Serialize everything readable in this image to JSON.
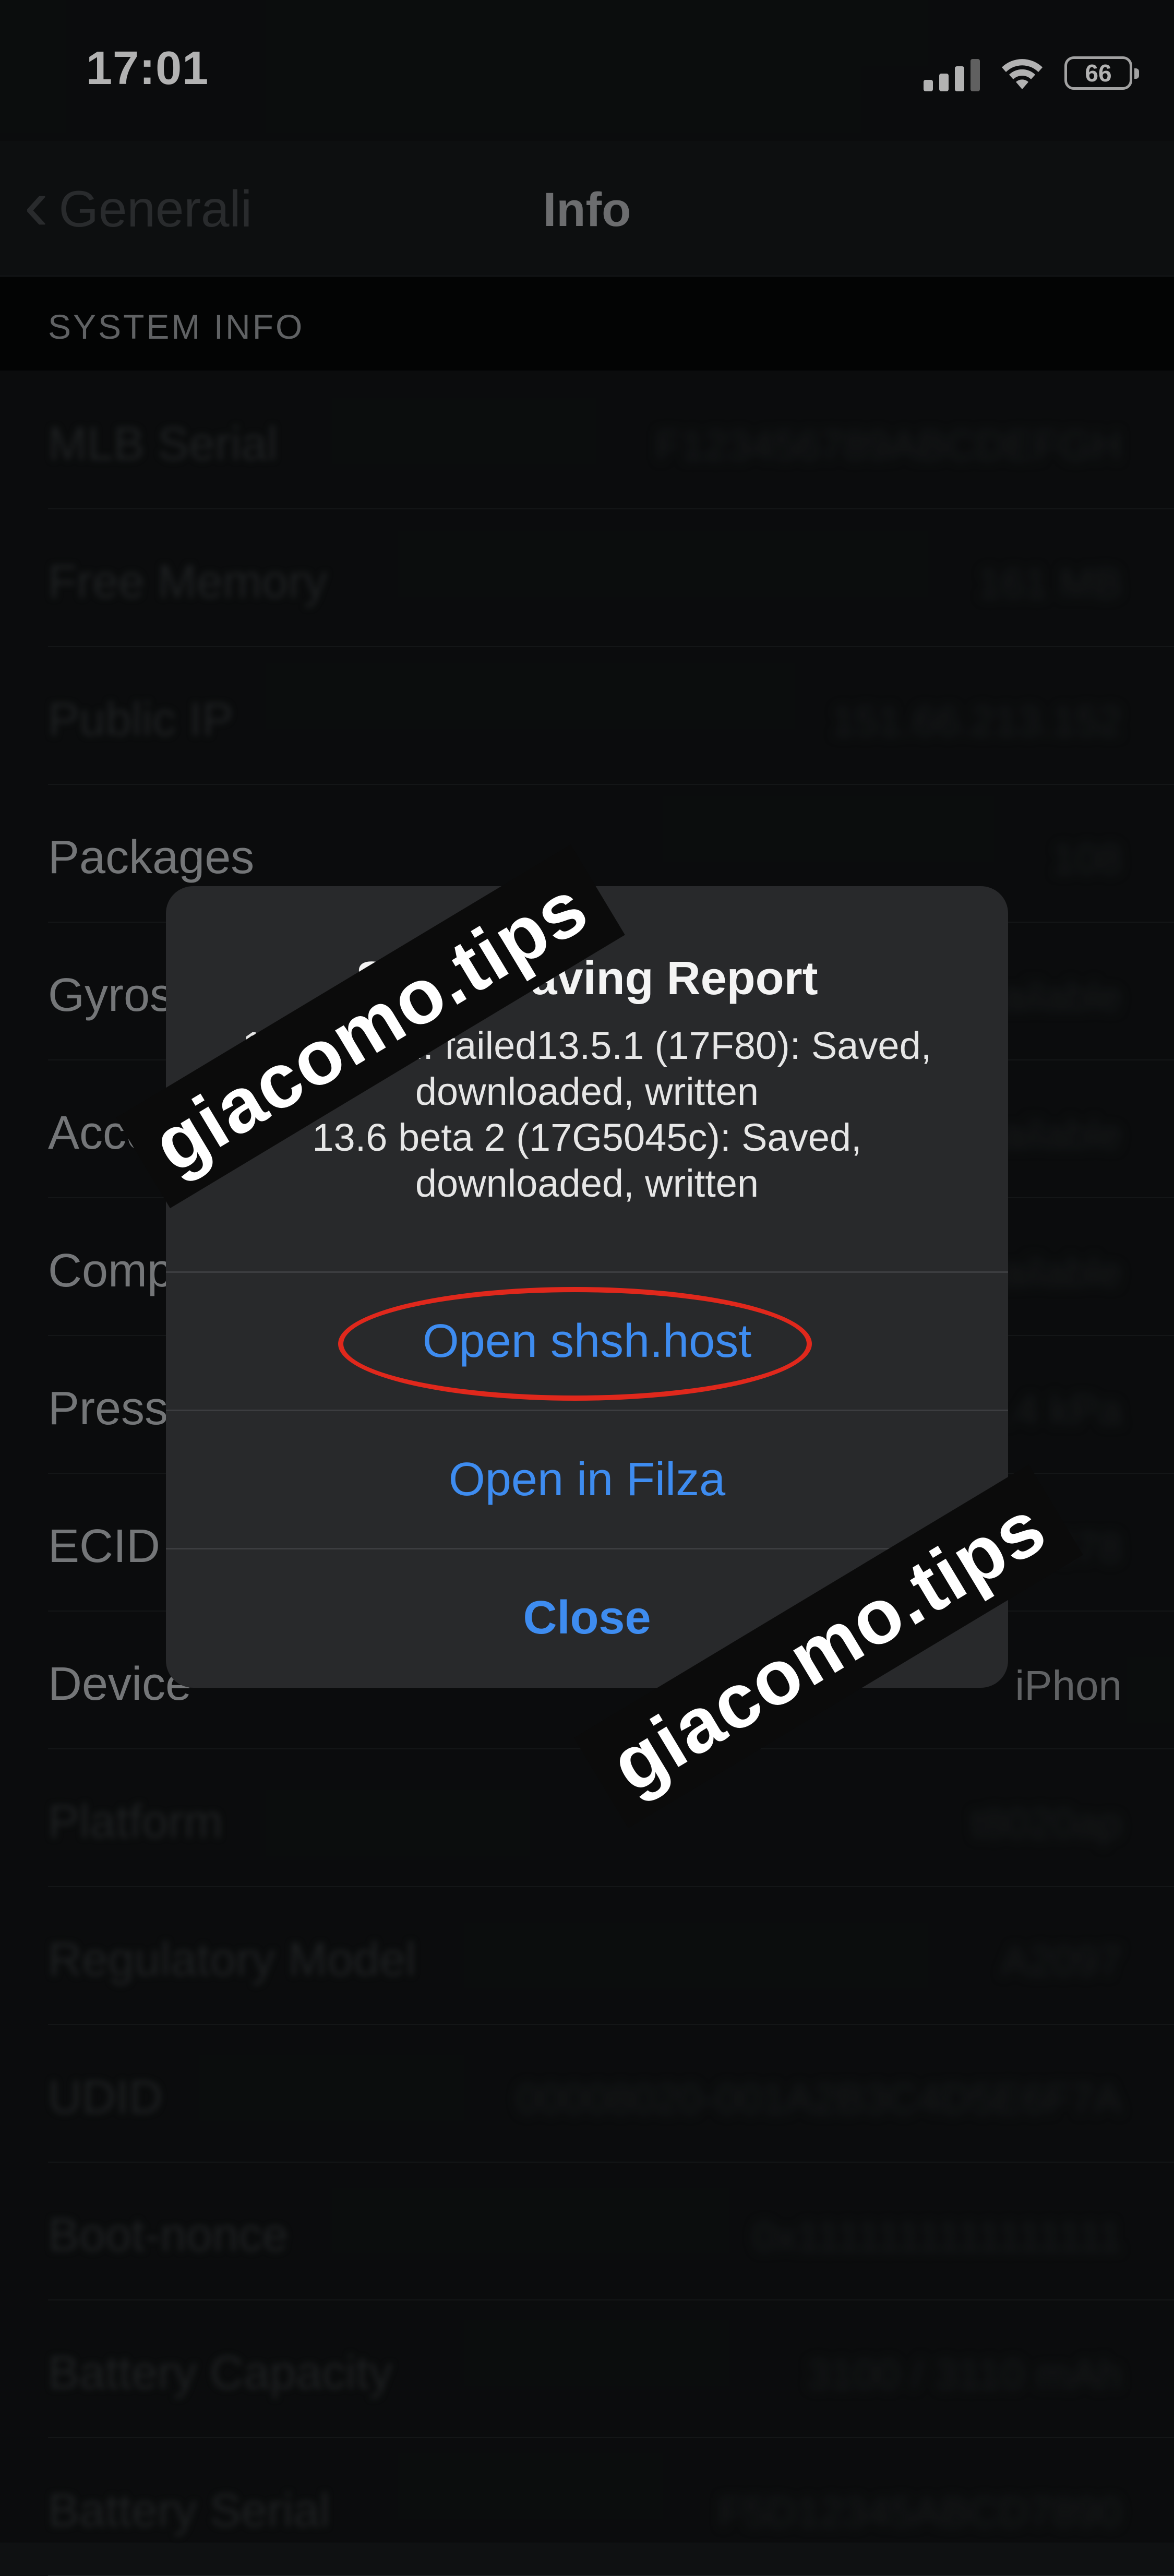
{
  "status_bar": {
    "time": "17:01",
    "battery_level": "66"
  },
  "nav": {
    "back_label": "Generali",
    "title": "Info"
  },
  "section": {
    "title": "SYSTEM INFO"
  },
  "rows": [
    {
      "label": "MLB Serial",
      "value": "F123456789ABCDEFGH"
    },
    {
      "label": "Free Memory",
      "value": "161 MB"
    },
    {
      "label": "Public IP",
      "value": "151.66.213.152"
    },
    {
      "label": "Packages",
      "value": "108"
    },
    {
      "label": "Gyros",
      "value": "Available"
    },
    {
      "label": "Accel",
      "value": "Available"
    },
    {
      "label": "Comp",
      "value": "Available"
    },
    {
      "label": "Press",
      "value": "101.4 kPa"
    },
    {
      "label": "ECID",
      "value": "0x12345678"
    },
    {
      "label": "Device",
      "value": "iPhon"
    },
    {
      "label": "Platform",
      "value": "t8020ap"
    },
    {
      "label": "Regulatory Model",
      "value": "A2097"
    },
    {
      "label": "UDID",
      "value": "00008020-001A2B3C4D5E6F7A"
    },
    {
      "label": "Boot-nonce",
      "value": "0x1111111111111111"
    },
    {
      "label": "Battery Capacity",
      "value": "3100 / 3110 mAh"
    },
    {
      "label": "Battery Serial",
      "value": "F5D12345ABCD7890"
    }
  ],
  "alert": {
    "title": "SHSH Saving Report",
    "message_lines": [
      "17G5035d: failed13.5.1 (17F80): Saved,",
      "downloaded, written",
      "13.6 beta 2 (17G5045c): Saved,",
      "downloaded, written"
    ],
    "actions": {
      "open_shsh": "Open shsh.host",
      "open_filza": "Open in Filza",
      "close": "Close"
    }
  },
  "watermarks": [
    "giacomo.tips",
    "giacomo.tips"
  ],
  "colors": {
    "accent": "#3e8cf0",
    "highlight": "#e0281c"
  }
}
